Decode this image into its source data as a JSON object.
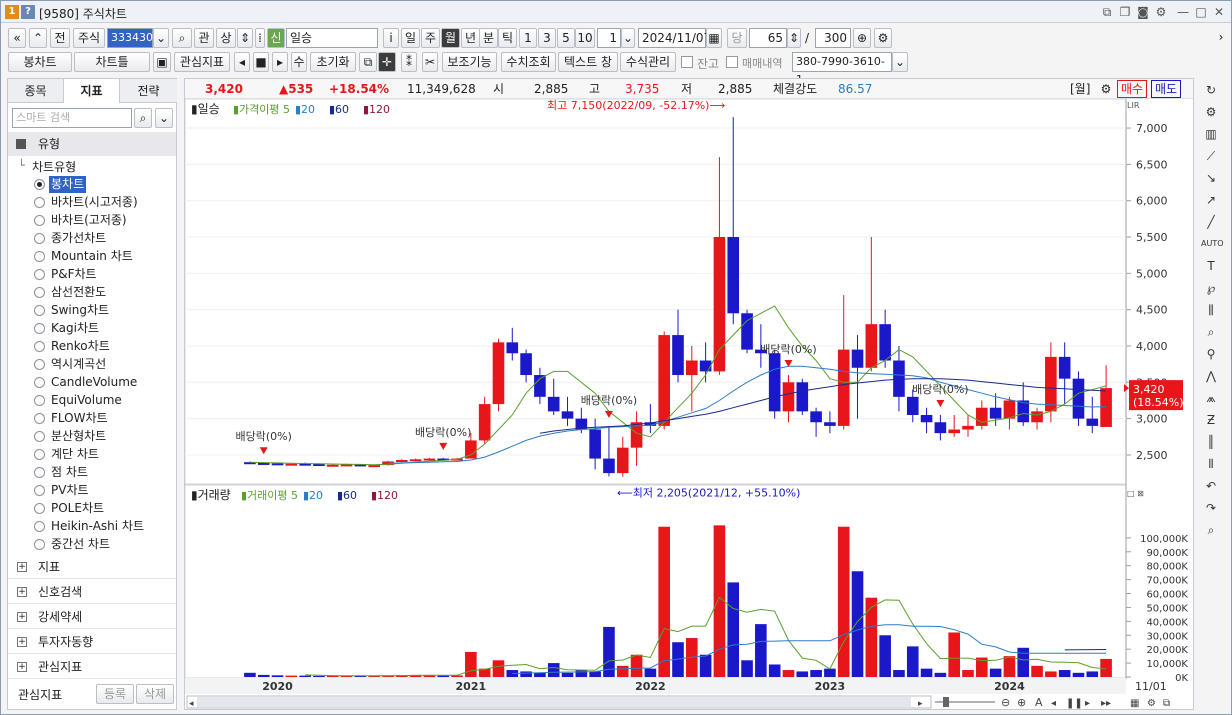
{
  "window": {
    "title_code": "[9580]",
    "title": "주식차트",
    "num_badge": "1",
    "help_badge": "?"
  },
  "toolbar1": {
    "nav_first": "«",
    "nav_up": "»",
    "prev": "전",
    "market": "주식",
    "code": "333430",
    "search_icon": "⌕",
    "gwan": "관",
    "sang": "상",
    "new_badge": "신",
    "stock_name": "일승",
    "info": "i",
    "period_day": "일",
    "period_week": "주",
    "period_month": "월",
    "period_year": "년",
    "period_min": "분",
    "period_tick": "틱",
    "n1": "1",
    "n3": "3",
    "n5": "5",
    "n10": "10",
    "count_box": "1",
    "date": "2024/11/07",
    "dang": "당",
    "view_count": "65",
    "slash": "/",
    "total_count": "300"
  },
  "toolbar2": {
    "candle_type": "봉차트",
    "chart_type": "차트틀",
    "interest": "관심지표",
    "su": "수",
    "reset": "초기화",
    "aux": "보조기능",
    "value_view": "수치조회",
    "text_window": "텍스트 창",
    "formula": "수식관리",
    "balance": "잔고",
    "trades": "매매내역",
    "account": "380-7990-3610-1"
  },
  "left": {
    "tabs": [
      "종목",
      "지표",
      "전략"
    ],
    "search_placeholder": "스마트 검색",
    "section": "유형",
    "tree_root": "차트유형",
    "items": [
      "봉차트",
      "바차트(시고저종)",
      "바차트(고저종)",
      "종가선차트",
      "Mountain 차트",
      "P&F차트",
      "삼선전환도",
      "Swing차트",
      "Kagi차트",
      "Renko차트",
      "역시계곡선",
      "CandleVolume",
      "EquiVolume",
      "FLOW차트",
      "분산형차트",
      "계단 차트",
      "점 차트",
      "PV차트",
      "POLE차트",
      "Heikin-Ashi 차트",
      "중간선 차트"
    ],
    "groups": [
      "지표",
      "신호검색",
      "강세약세",
      "투자자동향",
      "관심지표"
    ],
    "footer_label": "관심지표",
    "register": "등록",
    "delete": "삭제"
  },
  "info": {
    "price": "3,420",
    "change": "▲535",
    "pct": "+18.54%",
    "volume": "11,349,628",
    "open_label": "시",
    "open": "2,885",
    "high_label": "고",
    "high": "3,735",
    "low_label": "저",
    "low": "2,885",
    "strength_label": "체결강도",
    "strength": "86.57",
    "week": "[월]",
    "buy": "매수",
    "sell": "매도"
  },
  "colors": {
    "up": "#e8161b",
    "down": "#1a18c8",
    "ma5": "#5aa02c",
    "ma20": "#2d7cc6",
    "ma60": "#1a2a8a",
    "ma120": "#8a1a3a"
  },
  "chart_data": [
    {
      "type": "candlestick",
      "title": "일승",
      "legend": [
        "가격이평 5",
        "20",
        "60",
        "120"
      ],
      "ylim": [
        2100,
        7400
      ],
      "yticks": [
        2500,
        3000,
        3500,
        4000,
        4500,
        5000,
        5500,
        6000,
        6500,
        7000
      ],
      "yticklabels": [
        "2,500",
        "3,000",
        "3,500",
        "4,000",
        "4,500",
        "5,000",
        "5,500",
        "6,000",
        "6,500",
        "7,000"
      ],
      "x_labels": [
        "2020",
        "2021",
        "2022",
        "2023",
        "2024"
      ],
      "x_end_label": "11/01",
      "candles": [
        [
          2400,
          2410,
          2380,
          2390
        ],
        [
          2390,
          2400,
          2370,
          2385
        ],
        [
          2385,
          2395,
          2360,
          2370
        ],
        [
          2370,
          2390,
          2360,
          2380
        ],
        [
          2380,
          2395,
          2370,
          2375
        ],
        [
          2375,
          2385,
          2350,
          2360
        ],
        [
          2360,
          2375,
          2350,
          2365
        ],
        [
          2365,
          2380,
          2355,
          2370
        ],
        [
          2370,
          2375,
          2345,
          2350
        ],
        [
          2350,
          2370,
          2345,
          2360
        ],
        [
          2360,
          2420,
          2355,
          2410
        ],
        [
          2410,
          2440,
          2400,
          2430
        ],
        [
          2430,
          2450,
          2410,
          2440
        ],
        [
          2440,
          2460,
          2420,
          2450
        ],
        [
          2450,
          2460,
          2430,
          2440
        ],
        [
          2440,
          2460,
          2430,
          2450
        ],
        [
          2450,
          2800,
          2450,
          2700
        ],
        [
          2700,
          3300,
          2650,
          3200
        ],
        [
          3200,
          4100,
          3100,
          4050
        ],
        [
          4050,
          4250,
          3800,
          3900
        ],
        [
          3900,
          3950,
          3500,
          3600
        ],
        [
          3600,
          3700,
          3200,
          3300
        ],
        [
          3300,
          3550,
          3050,
          3100
        ],
        [
          3100,
          3300,
          2900,
          3000
        ],
        [
          3000,
          3150,
          2800,
          2850
        ],
        [
          2850,
          3000,
          2300,
          2450
        ],
        [
          2450,
          2900,
          2205,
          2250
        ],
        [
          2250,
          2750,
          2200,
          2600
        ],
        [
          2600,
          3100,
          2350,
          2950
        ],
        [
          2950,
          3200,
          2800,
          2900
        ],
        [
          2900,
          4200,
          2850,
          4150
        ],
        [
          4150,
          4500,
          3500,
          3600
        ],
        [
          3600,
          4000,
          3100,
          3800
        ],
        [
          3800,
          4050,
          3500,
          3650
        ],
        [
          3650,
          6600,
          3600,
          5500
        ],
        [
          5500,
          7150,
          4300,
          4450
        ],
        [
          4450,
          4500,
          3900,
          3950
        ],
        [
          3950,
          4300,
          3700,
          3900
        ],
        [
          3900,
          3950,
          3000,
          3100
        ],
        [
          3100,
          3600,
          2950,
          3500
        ],
        [
          3500,
          3550,
          3050,
          3100
        ],
        [
          3100,
          3150,
          2750,
          2950
        ],
        [
          2950,
          3100,
          2800,
          2900
        ],
        [
          2900,
          4700,
          2850,
          3950
        ],
        [
          3950,
          4150,
          3000,
          3700
        ],
        [
          3700,
          5500,
          3650,
          4300
        ],
        [
          4300,
          4500,
          3700,
          3800
        ],
        [
          3800,
          4000,
          3100,
          3300
        ],
        [
          3300,
          3400,
          2950,
          3050
        ],
        [
          3050,
          3150,
          2800,
          2950
        ],
        [
          2950,
          3050,
          2700,
          2800
        ],
        [
          2800,
          3050,
          2750,
          2850
        ],
        [
          2850,
          3050,
          2750,
          2900
        ],
        [
          2900,
          3250,
          2850,
          3150
        ],
        [
          3150,
          3350,
          2900,
          3000
        ],
        [
          3000,
          3300,
          2850,
          3250
        ],
        [
          3250,
          3500,
          2900,
          2950
        ],
        [
          2950,
          3150,
          2850,
          3100
        ],
        [
          3100,
          4050,
          2950,
          3850
        ],
        [
          3850,
          4050,
          3200,
          3550
        ],
        [
          3550,
          3650,
          2900,
          3000
        ],
        [
          3000,
          3300,
          2800,
          2900
        ],
        [
          2885,
          3735,
          2885,
          3420
        ]
      ],
      "ma5": [
        2400,
        2395,
        2390,
        2385,
        2382,
        2380,
        2376,
        2373,
        2370,
        2366,
        2372,
        2385,
        2400,
        2412,
        2425,
        2440,
        2500,
        2650,
        2850,
        3050,
        3350,
        3550,
        3650,
        3650,
        3500,
        3350,
        3100,
        2950,
        2800,
        2750,
        2950,
        3150,
        3350,
        3600,
        3950,
        4150,
        4350,
        4450,
        4550,
        4250,
        4000,
        3800,
        3550,
        3500,
        3500,
        3700,
        3800,
        3950,
        3850,
        3650,
        3450,
        3250,
        3050,
        2950,
        2980,
        3010,
        3070,
        3050,
        3100,
        3200,
        3350,
        3400,
        3450
      ],
      "ma20": [
        null,
        null,
        null,
        null,
        null,
        null,
        null,
        null,
        null,
        null,
        2385,
        2390,
        2395,
        2400,
        2405,
        2410,
        2430,
        2470,
        2540,
        2620,
        2700,
        2760,
        2800,
        2830,
        2850,
        2860,
        2880,
        2890,
        2900,
        2910,
        2960,
        3020,
        3080,
        3140,
        3250,
        3380,
        3500,
        3600,
        3680,
        3720,
        3720,
        3700,
        3680,
        3650,
        3630,
        3620,
        3610,
        3600,
        3590,
        3560,
        3500,
        3450,
        3400,
        3350,
        3300,
        3260,
        3220,
        3200,
        3190,
        3180,
        3170,
        3160,
        3165
      ],
      "ma60": [
        null,
        null,
        null,
        null,
        null,
        null,
        null,
        null,
        null,
        null,
        null,
        null,
        null,
        null,
        null,
        null,
        null,
        null,
        null,
        null,
        null,
        2800,
        2830,
        2850,
        2870,
        2880,
        2890,
        2900,
        2920,
        2940,
        2970,
        3000,
        3030,
        3060,
        3100,
        3150,
        3200,
        3250,
        3300,
        3340,
        3380,
        3410,
        3440,
        3470,
        3490,
        3510,
        3530,
        3540,
        3550,
        3550,
        3550,
        3540,
        3530,
        3510,
        3490,
        3470,
        3450,
        3430,
        3420,
        3410,
        3400,
        3390,
        3380
      ],
      "annotations": [
        {
          "text": "배당락(0%)",
          "index": 1
        },
        {
          "text": "배당락(0%)",
          "index": 14
        },
        {
          "text": "배당락(0%)",
          "index": 26
        },
        {
          "text": "배당락(0%)",
          "index": 39
        },
        {
          "text": "배당락(0%)",
          "index": 50
        }
      ],
      "high_label": "최고 7,150(2022/09, -52.17%)",
      "low_label": "최저 2,205(2021/12, +55.10%)",
      "current_label": "3,420",
      "current_pct": "(18.54%)"
    },
    {
      "type": "bar",
      "title": "거래량",
      "legend": [
        "거래이평 5",
        "20",
        "60",
        "120"
      ],
      "ylim": [
        0,
        115000
      ],
      "yticks": [
        0,
        10000,
        20000,
        30000,
        40000,
        50000,
        60000,
        70000,
        80000,
        90000,
        100000
      ],
      "yticklabels": [
        "0K",
        "10,000K",
        "20,000K",
        "30,000K",
        "40,000K",
        "50,000K",
        "60,000K",
        "70,000K",
        "80,000K",
        "90,000K",
        "100,000K"
      ],
      "values": [
        3000,
        1500,
        1200,
        1000,
        1000,
        800,
        900,
        900,
        800,
        900,
        1200,
        1300,
        1500,
        1200,
        1000,
        1100,
        18000,
        6000,
        12000,
        5000,
        4000,
        3000,
        10000,
        3000,
        5000,
        4000,
        36000,
        8000,
        16000,
        6000,
        108000,
        25000,
        28000,
        16000,
        109000,
        68000,
        12000,
        38000,
        9000,
        5000,
        4000,
        5000,
        6000,
        108000,
        76000,
        57000,
        30000,
        5000,
        22000,
        6000,
        3000,
        32000,
        5000,
        14000,
        6000,
        15000,
        21000,
        8000,
        4000,
        5000,
        3000,
        4000,
        13000
      ],
      "ma5": [
        null,
        null,
        null,
        null,
        1500,
        1200,
        1000,
        900,
        900,
        860,
        940,
        1020,
        1140,
        1200,
        1240,
        1260,
        4560,
        5460,
        7660,
        8460,
        9000,
        6000,
        6800,
        5200,
        5000,
        4800,
        11600,
        12200,
        15800,
        14000,
        34800,
        32600,
        36600,
        36600,
        57200,
        49200,
        46600,
        48600,
        47200,
        26400,
        13600,
        12000,
        5800,
        25400,
        39800,
        50000,
        55400,
        55200,
        38000,
        24000,
        13200,
        13600,
        13600,
        11800,
        12000,
        14400,
        12200,
        12800,
        10800,
        10600,
        10200,
        6800,
        5800
      ],
      "ma20": [
        null,
        null,
        null,
        null,
        null,
        null,
        null,
        null,
        null,
        null,
        null,
        null,
        null,
        null,
        null,
        null,
        null,
        null,
        null,
        2500,
        2800,
        3000,
        3400,
        3500,
        3700,
        3900,
        5500,
        5800,
        6300,
        6500,
        11800,
        12900,
        14300,
        15000,
        20000,
        23100,
        23500,
        25600,
        25800,
        26000,
        26000,
        26100,
        26000,
        30400,
        33800,
        36400,
        37600,
        37600,
        36500,
        36500,
        36300,
        34000,
        30800,
        23600,
        21600,
        18000,
        17000,
        17000,
        17000,
        17000,
        17000,
        17000,
        17000
      ],
      "ma60": [
        null,
        null,
        null,
        null,
        null,
        null,
        null,
        null,
        null,
        null,
        null,
        null,
        null,
        null,
        null,
        null,
        null,
        null,
        null,
        null,
        null,
        null,
        null,
        null,
        null,
        null,
        null,
        null,
        null,
        null,
        null,
        null,
        null,
        null,
        null,
        null,
        null,
        null,
        null,
        null,
        null,
        null,
        null,
        null,
        null,
        null,
        null,
        null,
        null,
        null,
        null,
        null,
        null,
        null,
        null,
        null,
        null,
        null,
        null,
        19500,
        19600,
        19700,
        19800
      ]
    }
  ],
  "scroll": {
    "a": "A"
  }
}
